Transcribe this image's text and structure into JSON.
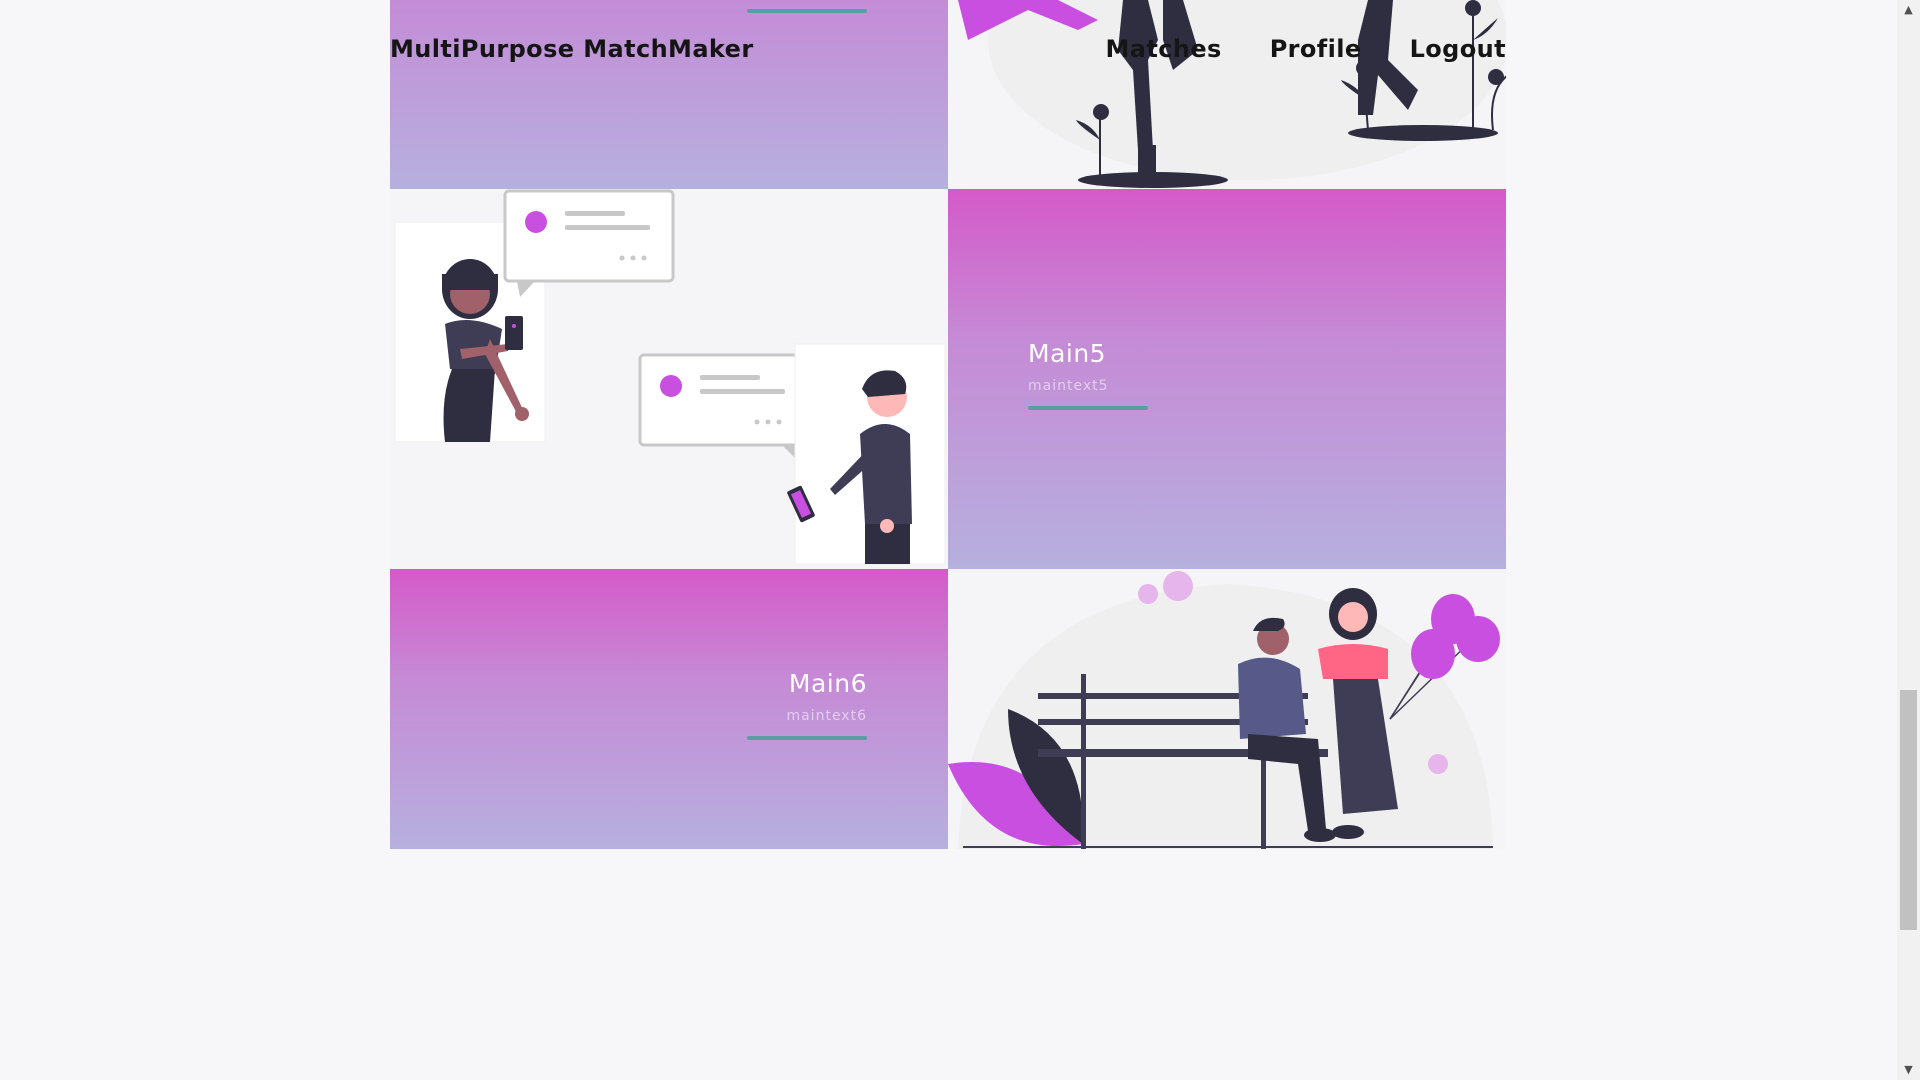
{
  "header": {
    "brand": "MultiPurpose MatchMaker",
    "nav": [
      "Matches",
      "Profile",
      "Logout"
    ]
  },
  "cards": [
    {
      "title": "Main5",
      "subtitle": "maintext5"
    },
    {
      "title": "Main6",
      "subtitle": "maintext6"
    }
  ],
  "colors": {
    "gradient_top": "#d45ac9",
    "gradient_bottom": "#b6b0de",
    "accent_line": "#5a9ea2",
    "accent_purple": "#c84fe0"
  },
  "scrollbar": {
    "up_arrow": "▲",
    "down_arrow": "▼"
  }
}
